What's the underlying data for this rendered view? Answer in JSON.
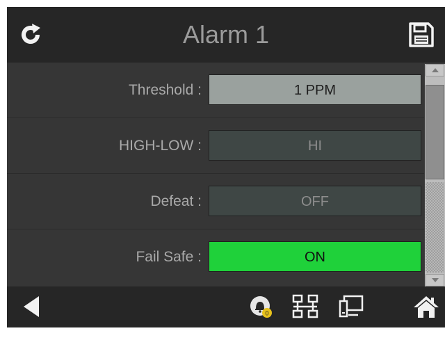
{
  "header": {
    "title": "Alarm 1",
    "refresh_icon": "refresh-icon",
    "save_icon": "floppy-disk-icon"
  },
  "settings": [
    {
      "label": "Threshold :",
      "value": "1 PPM",
      "style": "light"
    },
    {
      "label": "HIGH-LOW :",
      "value": "HI",
      "style": "dark"
    },
    {
      "label": "Defeat :",
      "value": "OFF",
      "style": "dark"
    },
    {
      "label": "Fail Safe :",
      "value": "ON",
      "style": "green"
    }
  ],
  "footer": {
    "icons": [
      "back-arrow-icon",
      "alarm-bell-icon",
      "network-icon",
      "device-icon",
      "home-icon"
    ],
    "alarm_badge": ""
  },
  "colors": {
    "header_bg": "#262626",
    "content_bg": "#363636",
    "title_text": "#9b9b9b",
    "value_light": "#9aa19e",
    "value_dark": "#3f4745",
    "value_green": "#1fd13a",
    "badge_yellow": "#e8c21c"
  }
}
